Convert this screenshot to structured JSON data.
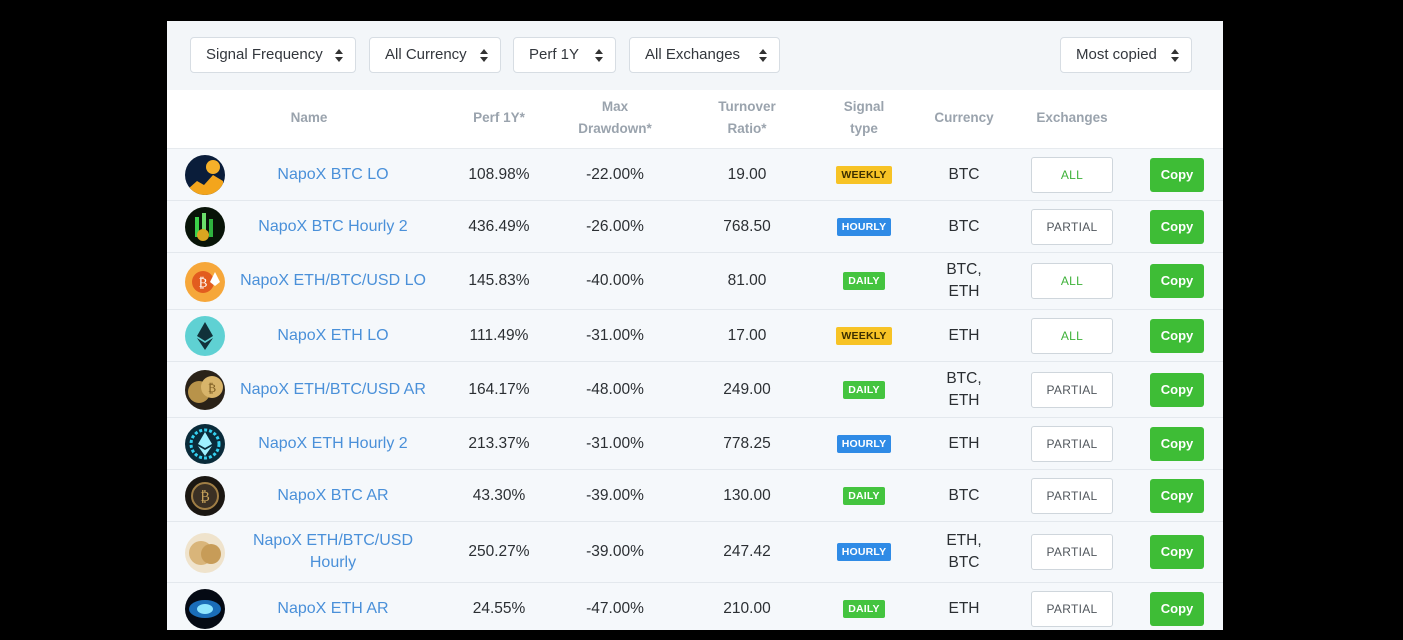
{
  "filters": {
    "signal_frequency": "Signal Frequency",
    "currency": "All Currency",
    "perf": "Perf 1Y",
    "exchanges": "All Exchanges",
    "sort": "Most copied"
  },
  "headers": {
    "name": "Name",
    "perf": "Perf 1Y*",
    "max_dd_1": "Max",
    "max_dd_2": "Drawdown*",
    "turnover_1": "Turnover",
    "turnover_2": "Ratio*",
    "signal_1": "Signal",
    "signal_2": "type",
    "currency": "Currency",
    "exchanges": "Exchanges"
  },
  "rows": [
    {
      "name": "NapoX BTC LO",
      "perf": "108.98%",
      "dd": "-22.00%",
      "turnover": "19.00",
      "signal": "WEEKLY",
      "signal_kind": "weekly",
      "currency": "BTC",
      "exchanges": "ALL",
      "exchange_kind": "all",
      "copy": "Copy",
      "icon": "btc-yellow-chart-icon"
    },
    {
      "name": "NapoX BTC Hourly 2",
      "perf": "436.49%",
      "dd": "-26.00%",
      "turnover": "768.50",
      "signal": "HOURLY",
      "signal_kind": "hourly",
      "currency": "BTC",
      "exchanges": "PARTIAL",
      "exchange_kind": "partial",
      "copy": "Copy",
      "icon": "green-candles-icon"
    },
    {
      "name": "NapoX ETH/BTC/USD LO",
      "perf": "145.83%",
      "dd": "-40.00%",
      "turnover": "81.00",
      "signal": "DAILY",
      "signal_kind": "daily",
      "currency": "BTC, ETH",
      "exchanges": "ALL",
      "exchange_kind": "all",
      "copy": "Copy",
      "icon": "btc-eth-orange-icon"
    },
    {
      "name": "NapoX ETH LO",
      "perf": "111.49%",
      "dd": "-31.00%",
      "turnover": "17.00",
      "signal": "WEEKLY",
      "signal_kind": "weekly",
      "currency": "ETH",
      "exchanges": "ALL",
      "exchange_kind": "all",
      "copy": "Copy",
      "icon": "eth-teal-icon"
    },
    {
      "name": "NapoX ETH/BTC/USD AR",
      "perf": "164.17%",
      "dd": "-48.00%",
      "turnover": "249.00",
      "signal": "DAILY",
      "signal_kind": "daily",
      "currency": "BTC, ETH",
      "exchanges": "PARTIAL",
      "exchange_kind": "partial",
      "copy": "Copy",
      "icon": "coins-gold-icon"
    },
    {
      "name": "NapoX ETH Hourly 2",
      "perf": "213.37%",
      "dd": "-31.00%",
      "turnover": "778.25",
      "signal": "HOURLY",
      "signal_kind": "hourly",
      "currency": "ETH",
      "exchanges": "PARTIAL",
      "exchange_kind": "partial",
      "copy": "Copy",
      "icon": "eth-blue-glow-icon"
    },
    {
      "name": "NapoX BTC AR",
      "perf": "43.30%",
      "dd": "-39.00%",
      "turnover": "130.00",
      "signal": "DAILY",
      "signal_kind": "daily",
      "currency": "BTC",
      "exchanges": "PARTIAL",
      "exchange_kind": "partial",
      "copy": "Copy",
      "icon": "btc-dark-coin-icon"
    },
    {
      "name": "NapoX ETH/BTC/USD Hourly",
      "perf": "250.27%",
      "dd": "-39.00%",
      "turnover": "247.42",
      "signal": "HOURLY",
      "signal_kind": "hourly",
      "currency": "ETH, BTC",
      "exchanges": "PARTIAL",
      "exchange_kind": "partial",
      "copy": "Copy",
      "icon": "coins-stack-icon"
    },
    {
      "name": "NapoX ETH AR",
      "perf": "24.55%",
      "dd": "-47.00%",
      "turnover": "210.00",
      "signal": "DAILY",
      "signal_kind": "daily",
      "currency": "ETH",
      "exchanges": "PARTIAL",
      "exchange_kind": "partial",
      "copy": "Copy",
      "icon": "eth-space-icon"
    }
  ],
  "colors": {
    "link": "#4a90d9",
    "weekly": "#f7c325",
    "hourly": "#2f8be6",
    "daily": "#44c43f",
    "copy": "#3ebd36"
  }
}
